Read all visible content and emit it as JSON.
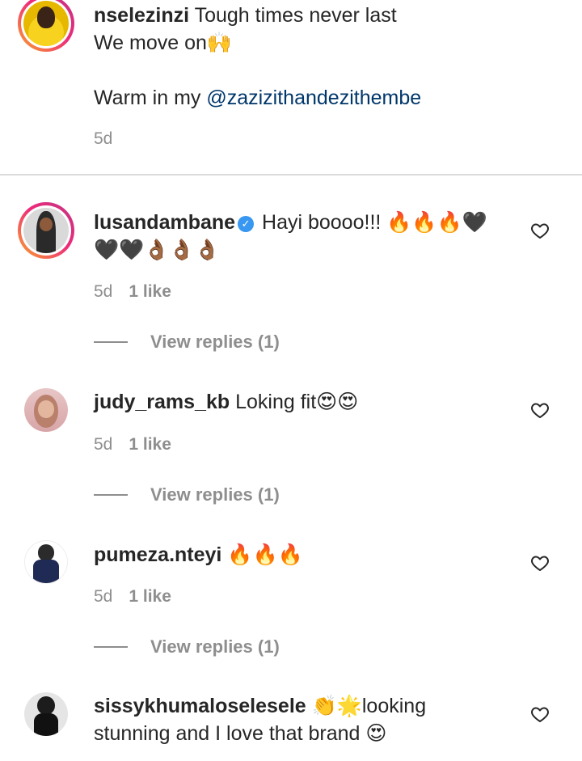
{
  "comments": [
    {
      "username": "nselezinzi",
      "line1": "Tough times never last",
      "line2": "We move on🙌",
      "line3_prefix": "Warm in my ",
      "mention": "@zazizithandezithembe",
      "time": "5d"
    },
    {
      "username": "lusandambane",
      "verified_mark": "✓",
      "text_line1": "Hayi boooo!!! 🔥🔥🔥🖤",
      "text_line2": "🖤🖤👌🏾👌🏾👌🏾",
      "time": "5d",
      "likes": "1 like",
      "replies": "View replies (1)"
    },
    {
      "username": "judy_rams_kb",
      "text": "Loking fit😍😍",
      "time": "5d",
      "likes": "1 like",
      "replies": "View replies (1)"
    },
    {
      "username": "pumeza.nteyi",
      "text": "🔥🔥🔥",
      "time": "5d",
      "likes": "1 like",
      "replies": "View replies (1)"
    },
    {
      "username": "sissykhumaloselesele",
      "text_line1": "👏🌟looking",
      "text_line2": "stunning and I love that brand 😍"
    }
  ],
  "icons": {
    "like": "heart-outline-icon",
    "verified": "verified-badge-icon"
  },
  "colors": {
    "mention": "#00376b",
    "verified": "#3897f0",
    "muted": "#8e8e8e"
  }
}
